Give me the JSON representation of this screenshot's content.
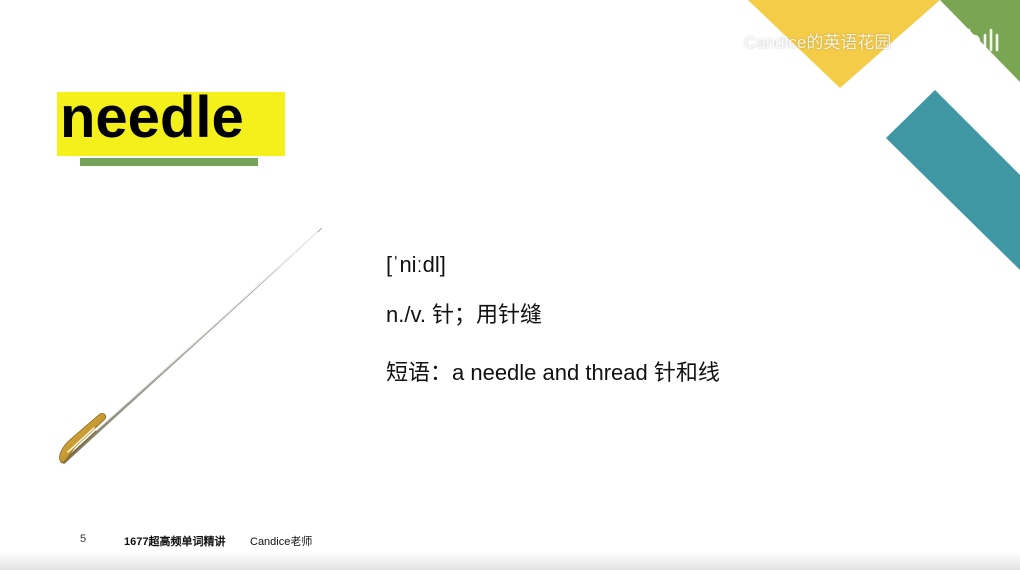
{
  "slide": {
    "word": "needle",
    "phonetic": "[ˈniːdl]",
    "definition": "n./v. 针；用针缝",
    "phrase": "短语：a needle and thread 针和线"
  },
  "footer": {
    "page_number": "5",
    "course_title": "1677超高频单词精讲",
    "teacher": "Candice老师"
  },
  "watermark": {
    "channel": "Candice的英语花园",
    "logo": "bilibili"
  },
  "colors": {
    "highlight_yellow": "#f4f01b",
    "underline_green": "#76a35a",
    "triangle_yellow": "#f5cc48",
    "triangle_green": "#7aa654",
    "band_teal": "#3f97a3"
  },
  "icons": {
    "needle": "needle-illustration",
    "logo": "bilibili-logo"
  }
}
